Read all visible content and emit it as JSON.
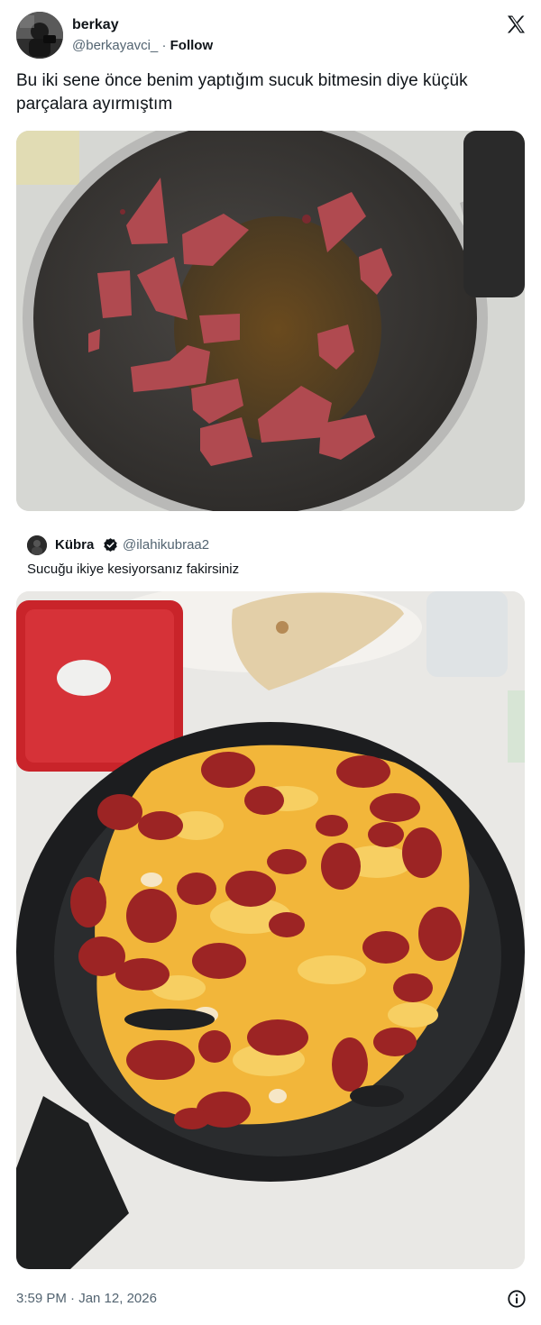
{
  "tweet": {
    "author_name": "berkay",
    "author_handle": "@berkayavci_",
    "separator": "·",
    "follow_label": "Follow",
    "text": "Bu iki sene önce benim yaptığım sucuk bitmesin diye küçük parçalara ayırmıştım",
    "timestamp": "3:59 PM · Jan 12, 2026"
  },
  "quoted_tweet": {
    "author_name": "Kübra",
    "author_handle": "@ilahikubraa2",
    "text": "Sucuğu ikiye kesiyorsanız fakirsiniz"
  },
  "icons": {
    "platform_logo": "x-logo-icon",
    "verified_badge": "verified-badge-icon",
    "info": "info-icon"
  },
  "colors": {
    "text_primary": "#0f1419",
    "text_secondary": "#536471",
    "background": "#ffffff"
  }
}
